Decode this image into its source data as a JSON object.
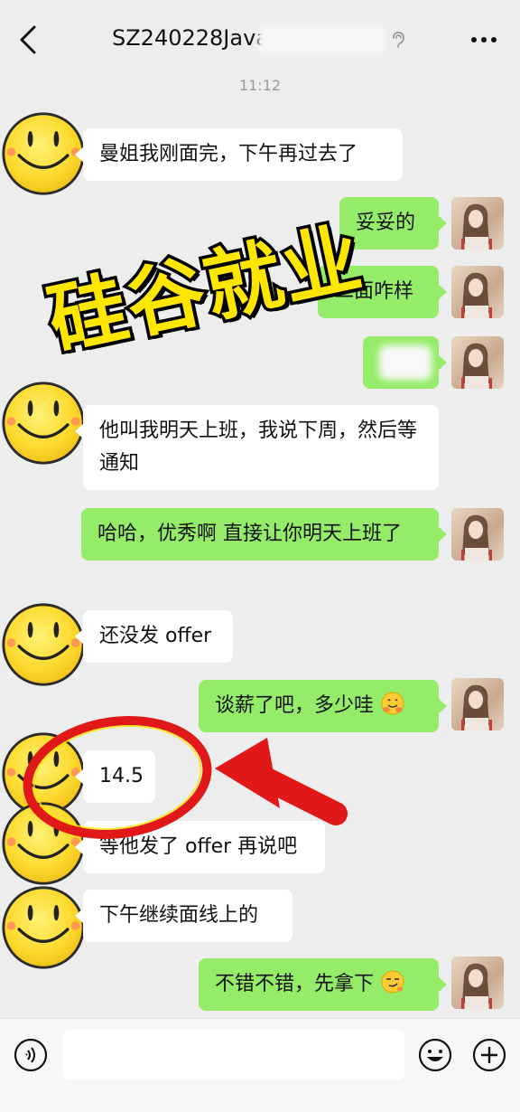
{
  "header": {
    "title": "SZ240228Java"
  },
  "timestamp": "11:12",
  "watermark": "硅谷就业",
  "messages": {
    "m1": "曼姐我刚面完，下午再过去了",
    "m2": "妥妥的",
    "m3": "二面咋样",
    "m5": "他叫我明天上班，我说下周，然后等通知",
    "m6": "哈哈，优秀啊 直接让你明天上班了",
    "m7": "还没发 offer",
    "m8": "谈薪了吧，多少哇",
    "m9": "14.5",
    "m10": "等他发了 offer 再说吧",
    "m11": "下午继续面线上的",
    "m12": "不错不错，先拿下"
  },
  "icons": [
    "back-icon",
    "ear-icon",
    "more-icon",
    "voice-icon",
    "emoji-icon",
    "plus-icon"
  ]
}
